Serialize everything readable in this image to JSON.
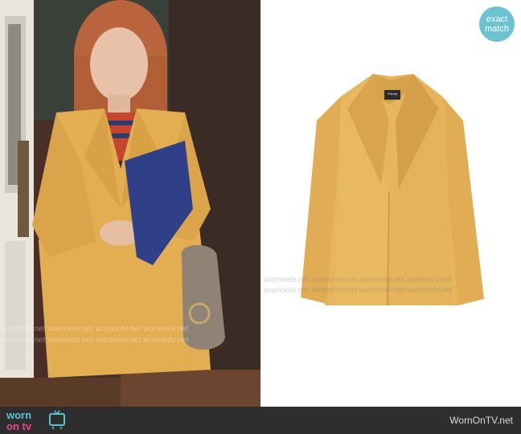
{
  "badge": {
    "line1": "exact",
    "line2": "match"
  },
  "watermark": "wornontv.net",
  "footer": {
    "logo_top": "worn",
    "logo_bottom": "on tv",
    "site": "WornOnTV.net"
  },
  "product": {
    "label": "Theory"
  },
  "colors": {
    "coat": "#e3ae52",
    "footer": "#2e2e2e",
    "badge": "#6cc3cf"
  }
}
